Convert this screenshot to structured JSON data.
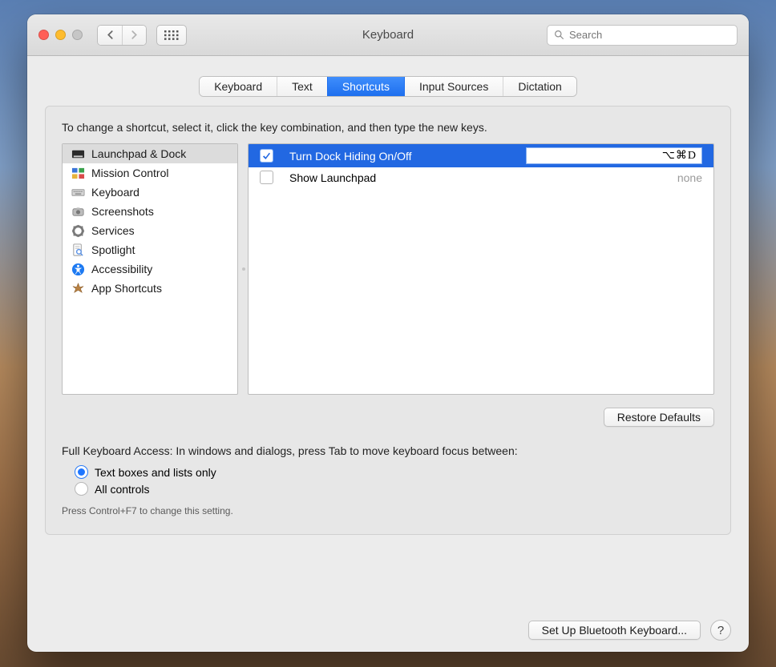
{
  "title": "Keyboard",
  "search": {
    "placeholder": "Search",
    "value": ""
  },
  "tabs": [
    {
      "label": "Keyboard",
      "active": false
    },
    {
      "label": "Text",
      "active": false
    },
    {
      "label": "Shortcuts",
      "active": true
    },
    {
      "label": "Input Sources",
      "active": false
    },
    {
      "label": "Dictation",
      "active": false
    }
  ],
  "instruction": "To change a shortcut, select it, click the key combination, and then type the new keys.",
  "categories": [
    {
      "label": "Launchpad & Dock",
      "icon": "launchpad",
      "selected": true
    },
    {
      "label": "Mission Control",
      "icon": "mission-control",
      "selected": false
    },
    {
      "label": "Keyboard",
      "icon": "keyboard",
      "selected": false
    },
    {
      "label": "Screenshots",
      "icon": "screenshots",
      "selected": false
    },
    {
      "label": "Services",
      "icon": "services",
      "selected": false
    },
    {
      "label": "Spotlight",
      "icon": "spotlight",
      "selected": false
    },
    {
      "label": "Accessibility",
      "icon": "accessibility",
      "selected": false
    },
    {
      "label": "App Shortcuts",
      "icon": "app-shortcuts",
      "selected": false
    }
  ],
  "shortcuts": [
    {
      "label": "Turn Dock Hiding On/Off",
      "checked": true,
      "selected": true,
      "key": "⌥⌘D"
    },
    {
      "label": "Show Launchpad",
      "checked": false,
      "selected": false,
      "key": "none"
    }
  ],
  "restore_label": "Restore Defaults",
  "fka": {
    "header": "Full Keyboard Access: In windows and dialogs, press Tab to move keyboard focus between:",
    "options": [
      {
        "label": "Text boxes and lists only",
        "on": true
      },
      {
        "label": "All controls",
        "on": false
      }
    ],
    "hint": "Press Control+F7 to change this setting."
  },
  "footer": {
    "bluetooth_label": "Set Up Bluetooth Keyboard...",
    "help_label": "?"
  }
}
